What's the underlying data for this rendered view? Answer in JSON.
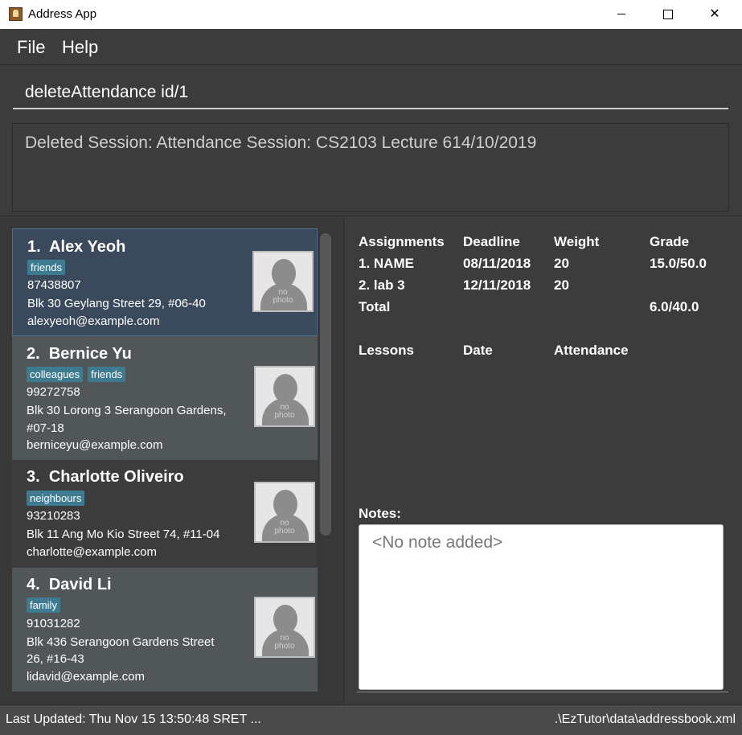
{
  "window": {
    "title": "Address App",
    "minimize_icon": "minimize-icon",
    "maximize_icon": "maximize-icon",
    "close_icon": "close-icon",
    "close_glyph": "✕"
  },
  "menu": {
    "file": "File",
    "help": "Help"
  },
  "command": {
    "value": "deleteAttendance id/1"
  },
  "result": {
    "text": "Deleted Session: Attendance Session: CS2103 Lecture 614/10/2019"
  },
  "persons": [
    {
      "index": "1.",
      "name": "Alex Yeoh",
      "tags": [
        "friends"
      ],
      "phone": "87438807",
      "address": [
        "Blk 30 Geylang Street 29, #06-40"
      ],
      "email": "alexyeoh@example.com",
      "photo_text": [
        "no",
        "photo"
      ]
    },
    {
      "index": "2.",
      "name": "Bernice Yu",
      "tags": [
        "colleagues",
        "friends"
      ],
      "phone": "99272758",
      "address": [
        "Blk 30 Lorong 3 Serangoon Gardens,",
        "#07-18"
      ],
      "email": "berniceyu@example.com",
      "photo_text": [
        "no",
        "photo"
      ]
    },
    {
      "index": "3.",
      "name": "Charlotte Oliveiro",
      "tags": [
        "neighbours"
      ],
      "phone": "93210283",
      "address": [
        "Blk 11 Ang Mo Kio Street 74, #11-04"
      ],
      "email": "charlotte@example.com",
      "photo_text": [
        "no",
        "photo"
      ]
    },
    {
      "index": "4.",
      "name": "David Li",
      "tags": [
        "family"
      ],
      "phone": "91031282",
      "address": [
        "Blk 436 Serangoon Gardens Street",
        "26, #16-43"
      ],
      "email": "lidavid@example.com",
      "photo_text": [
        "no",
        "photo"
      ]
    }
  ],
  "details": {
    "assignments_header": {
      "assignments": "Assignments",
      "deadline": "Deadline",
      "weight": "Weight",
      "grade": "Grade"
    },
    "assignments": [
      {
        "name": "1. NAME",
        "deadline": "08/11/2018",
        "weight": "20",
        "grade": "15.0/50.0"
      },
      {
        "name": "2. lab 3",
        "deadline": "12/11/2018",
        "weight": "20",
        "grade": ""
      }
    ],
    "total": {
      "label": "Total",
      "grade": "6.0/40.0"
    },
    "lessons_header": {
      "lessons": "Lessons",
      "date": "Date",
      "attendance": "Attendance"
    },
    "notes_label": "Notes:",
    "notes_placeholder": "<No note added>"
  },
  "status": {
    "left": "Last Updated: Thu Nov 15 13:50:48 SRET ...",
    "right": ".\\EzTutor\\data\\addressbook.xml"
  },
  "colors": {
    "tag_bg": "#3e7b91",
    "selected_card": "#3a4a5c",
    "alt_card": "#515658",
    "background": "#3c3c3c"
  }
}
